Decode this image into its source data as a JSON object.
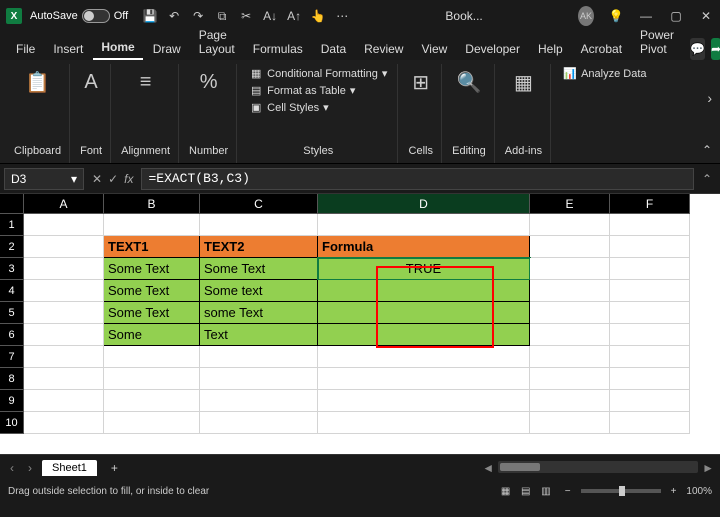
{
  "titlebar": {
    "autosave_label": "AutoSave",
    "autosave_state": "Off",
    "doc_title": "Book...",
    "user_initials": "AK"
  },
  "menu": {
    "file": "File",
    "insert": "Insert",
    "home": "Home",
    "draw": "Draw",
    "page_layout": "Page Layout",
    "formulas": "Formulas",
    "data": "Data",
    "review": "Review",
    "view": "View",
    "developer": "Developer",
    "help": "Help",
    "acrobat": "Acrobat",
    "power_pivot": "Power Pivot"
  },
  "ribbon": {
    "clipboard": "Clipboard",
    "font": "Font",
    "alignment": "Alignment",
    "number": "Number",
    "cond_fmt": "Conditional Formatting",
    "fmt_table": "Format as Table",
    "cell_styles": "Cell Styles",
    "styles": "Styles",
    "cells": "Cells",
    "editing": "Editing",
    "addins": "Add-ins",
    "analyze": "Analyze Data"
  },
  "namebox": "D3",
  "formula": "=EXACT(B3,C3)",
  "columns": [
    "A",
    "B",
    "C",
    "D",
    "E",
    "F"
  ],
  "headers": {
    "b": "TEXT1",
    "c": "TEXT2",
    "d": "Formula"
  },
  "cells": {
    "b3": "Some Text",
    "c3": "Some Text",
    "d3": "TRUE",
    "b4": "Some Text",
    "c4": "Some text",
    "b5": "Some Text",
    "c5": "some Text",
    "b6": "Some",
    "c6": "Text"
  },
  "sheet": "Sheet1",
  "status": "Drag outside selection to fill, or inside to clear",
  "zoom": "100%"
}
